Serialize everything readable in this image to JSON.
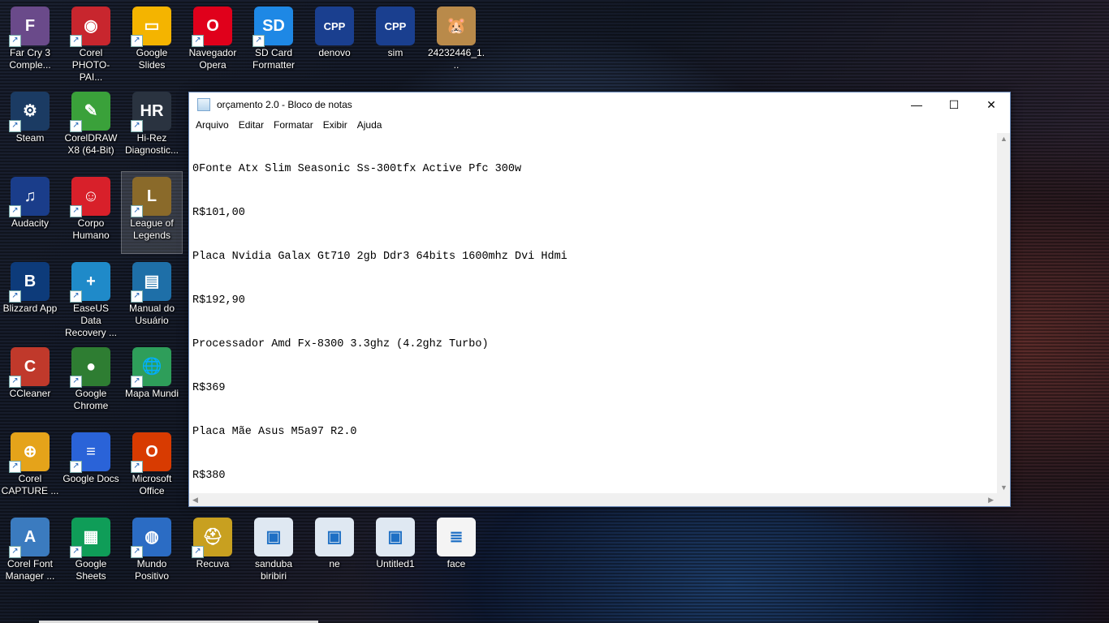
{
  "desktop_icons": [
    {
      "id": "farcry",
      "label": "Far Cry 3 Comple...",
      "icon": "farcry-icon",
      "color": "#6a4a8a",
      "glyph": "F"
    },
    {
      "id": "corel-photopaint",
      "label": "Corel PHOTO-PAI...",
      "icon": "corel-photopaint-icon",
      "color": "#c8262e",
      "glyph": "◉"
    },
    {
      "id": "google-slides",
      "label": "Google Slides",
      "icon": "google-slides-icon",
      "color": "#f4b400",
      "glyph": "▭"
    },
    {
      "id": "opera",
      "label": "Navegador Opera",
      "icon": "opera-icon",
      "color": "#e0001b",
      "glyph": "O"
    },
    {
      "id": "sdcard",
      "label": "SD Card Formatter",
      "icon": "sdcard-icon",
      "color": "#1e88e5",
      "glyph": "SD"
    },
    {
      "id": "denovo",
      "label": "denovo",
      "icon": "devcpp-icon",
      "color": "#1a3f8f",
      "glyph": "CPP"
    },
    {
      "id": "sim",
      "label": "sim",
      "icon": "devcpp-icon",
      "color": "#1a3f8f",
      "glyph": "CPP"
    },
    {
      "id": "photo",
      "label": "24232446_1...",
      "icon": "image-file-icon",
      "color": "#b98a4a",
      "glyph": "🐹"
    },
    {
      "id": "steam",
      "label": "Steam",
      "icon": "steam-icon",
      "color": "#1b3b63",
      "glyph": "⚙"
    },
    {
      "id": "coreldraw",
      "label": "CorelDRAW X8 (64-Bit)",
      "icon": "coreldraw-icon",
      "color": "#3aa13a",
      "glyph": "✎"
    },
    {
      "id": "hirez",
      "label": "Hi-Rez Diagnostic...",
      "icon": "hirez-icon",
      "color": "#2a3340",
      "glyph": "HR"
    },
    {
      "id": "audacity",
      "label": "Audacity",
      "icon": "audacity-icon",
      "color": "#1a3d8a",
      "glyph": "♫"
    },
    {
      "id": "corpo",
      "label": "Corpo Humano",
      "icon": "corpo-humano-icon",
      "color": "#d8202a",
      "glyph": "☺"
    },
    {
      "id": "lol",
      "label": "League of Legends",
      "icon": "league-of-legends-icon",
      "color": "#8a6a2a",
      "glyph": "L"
    },
    {
      "id": "blizzard",
      "label": "Blizzard App",
      "icon": "blizzard-icon",
      "color": "#0d3b7a",
      "glyph": "B"
    },
    {
      "id": "easeus",
      "label": "EaseUS Data Recovery ...",
      "icon": "easeus-icon",
      "color": "#1f8ac9",
      "glyph": "+"
    },
    {
      "id": "manual",
      "label": "Manual do Usuário",
      "icon": "manual-icon",
      "color": "#1e6fa8",
      "glyph": "▤"
    },
    {
      "id": "ccleaner",
      "label": "CCleaner",
      "icon": "ccleaner-icon",
      "color": "#c0392b",
      "glyph": "C"
    },
    {
      "id": "chrome",
      "label": "Google Chrome",
      "icon": "chrome-icon",
      "color": "#2e7d32",
      "glyph": "●"
    },
    {
      "id": "mapamundi",
      "label": "Mapa Mundi",
      "icon": "globe-icon",
      "color": "#2e9e5a",
      "glyph": "🌐"
    },
    {
      "id": "corelcapture",
      "label": "Corel CAPTURE ...",
      "icon": "corel-capture-icon",
      "color": "#e5a31a",
      "glyph": "⊕"
    },
    {
      "id": "googledocs",
      "label": "Google Docs",
      "icon": "google-docs-icon",
      "color": "#2a63d8",
      "glyph": "≡"
    },
    {
      "id": "msoffice",
      "label": "Microsoft Office",
      "icon": "microsoft-office-icon",
      "color": "#d83b01",
      "glyph": "O"
    },
    {
      "id": "corelfont",
      "label": "Corel Font Manager ...",
      "icon": "corel-font-icon",
      "color": "#3b7bbf",
      "glyph": "A"
    },
    {
      "id": "googlesheets",
      "label": "Google Sheets",
      "icon": "google-sheets-icon",
      "color": "#0f9d58",
      "glyph": "▦"
    },
    {
      "id": "mundopositivo",
      "label": "Mundo Positivo",
      "icon": "mundo-positivo-icon",
      "color": "#2b6cc4",
      "glyph": "◍"
    },
    {
      "id": "recuva",
      "label": "Recuva",
      "icon": "recuva-icon",
      "color": "#c8a020",
      "glyph": "⛑"
    },
    {
      "id": "sanduba",
      "label": "sanduba biribiri",
      "icon": "window-file-icon",
      "color": "#dfe8f2",
      "glyph": "▣"
    },
    {
      "id": "ne",
      "label": "ne",
      "icon": "window-file-icon",
      "color": "#dfe8f2",
      "glyph": "▣"
    },
    {
      "id": "untitled1",
      "label": "Untitled1",
      "icon": "window-file-icon",
      "color": "#dfe8f2",
      "glyph": "▣"
    },
    {
      "id": "face",
      "label": "face",
      "icon": "text-file-icon",
      "color": "#f4f4f4",
      "glyph": "≣"
    }
  ],
  "notepad": {
    "title": "orçamento 2.0 - Bloco de notas",
    "menu": [
      "Arquivo",
      "Editar",
      "Formatar",
      "Exibir",
      "Ajuda"
    ],
    "lines": [
      "0Fonte Atx Slim Seasonic Ss-300tfx Active Pfc 300w",
      "R$101,00",
      "Placa Nvidia Galax Gt710 2gb Ddr3 64bits 1600mhz Dvi Hdmi",
      "R$192,90",
      "Processador Amd Fx-8300 3.3ghz (4.2ghz Turbo)",
      "R$369",
      "Placa Mãe Asus M5a97 R2.0",
      "R$380"
    ],
    "minimize_glyph": "—",
    "maximize_glyph": "☐",
    "close_glyph": "✕"
  }
}
